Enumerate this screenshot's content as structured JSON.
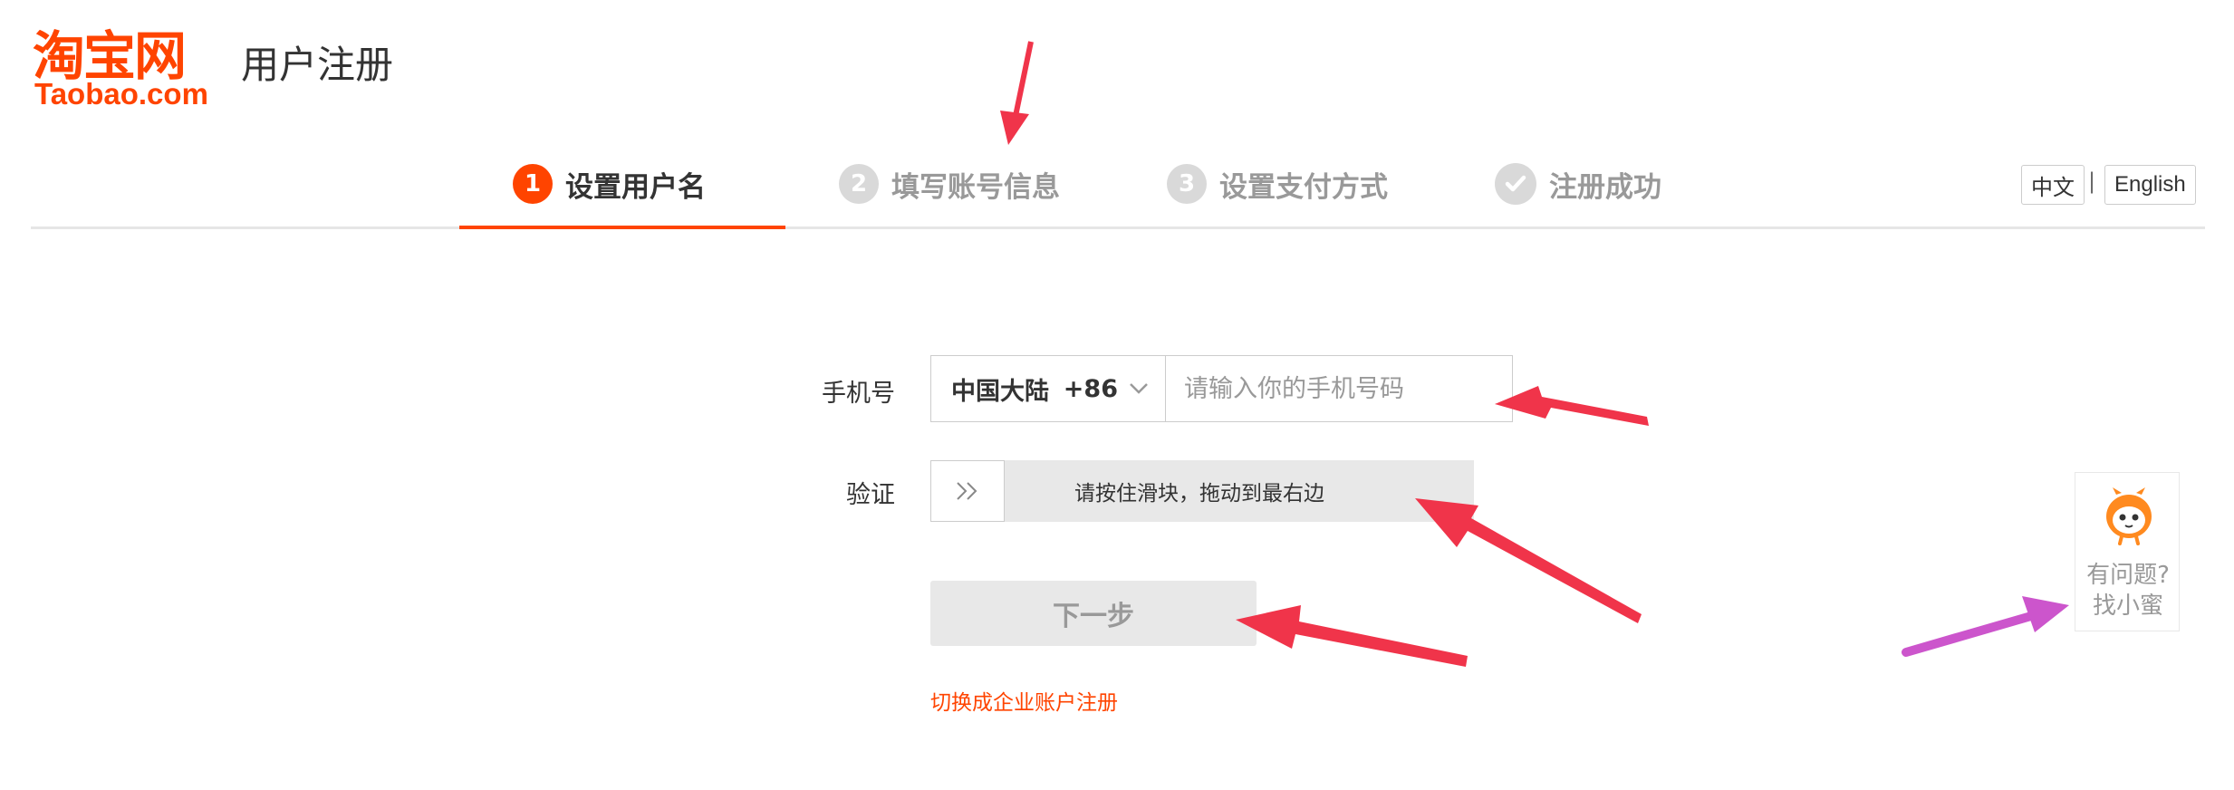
{
  "header": {
    "logo_cn": "淘宝网",
    "logo_en": "Taobao.com",
    "page_title": "用户注册"
  },
  "steps": [
    {
      "num": "1",
      "label": "设置用户名",
      "state": "active"
    },
    {
      "num": "2",
      "label": "填写账号信息",
      "state": "pending"
    },
    {
      "num": "3",
      "label": "设置支付方式",
      "state": "pending"
    },
    {
      "num": "",
      "label": "注册成功",
      "state": "pending",
      "icon": "check-icon"
    }
  ],
  "language": {
    "options": [
      "中文",
      "English"
    ],
    "separator": "|"
  },
  "form": {
    "phone_label": "手机号",
    "region_name": "中国大陆",
    "region_code": "+86",
    "phone_placeholder": "请输入你的手机号码",
    "verify_label": "验证",
    "slider_text": "请按住滑块，拖动到最右边",
    "next_button": "下一步",
    "enterprise_link": "切换成企业账户注册"
  },
  "help_widget": {
    "line1": "有问题?",
    "line2": "找小蜜",
    "icon": "mascot-icon"
  },
  "colors": {
    "brand": "#ff4400",
    "annotation_red": "#f0344a",
    "annotation_purple": "#cc55cc",
    "disabled_bg": "#e8e8e8"
  }
}
